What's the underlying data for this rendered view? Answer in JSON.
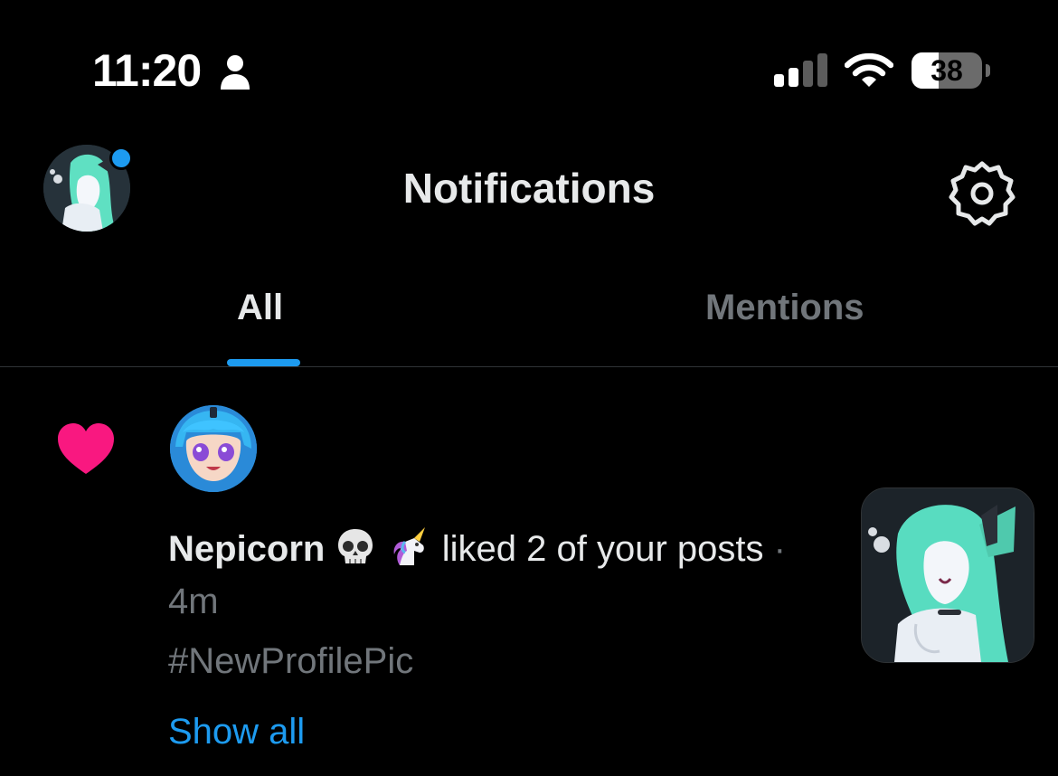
{
  "status_bar": {
    "time": "11:20",
    "focus_icon": "person-icon",
    "signal_icon": "cellular-signal-icon",
    "wifi_icon": "wifi-icon",
    "battery_level": "38",
    "battery_fraction": 0.38
  },
  "header": {
    "title": "Notifications",
    "avatar": "profile-avatar",
    "settings_icon": "gear-icon"
  },
  "tabs": [
    {
      "label": "All",
      "selected": true
    },
    {
      "label": "Mentions",
      "selected": false
    }
  ],
  "notification": {
    "type_icon": "heart-icon",
    "actor_name": "Nepicorn",
    "actor_emojis": [
      "skull-emoji",
      "unicorn-emoji"
    ],
    "action_text": "liked 2 of your posts",
    "separator": "·",
    "time_ago": "4m",
    "post_text": "#NewProfilePic",
    "show_all_label": "Show all"
  },
  "colors": {
    "background": "#000000",
    "text_primary": "#e7e9ea",
    "text_secondary": "#71767b",
    "accent": "#1d9bf0",
    "like": "#f91880",
    "divider": "#2f3336"
  }
}
